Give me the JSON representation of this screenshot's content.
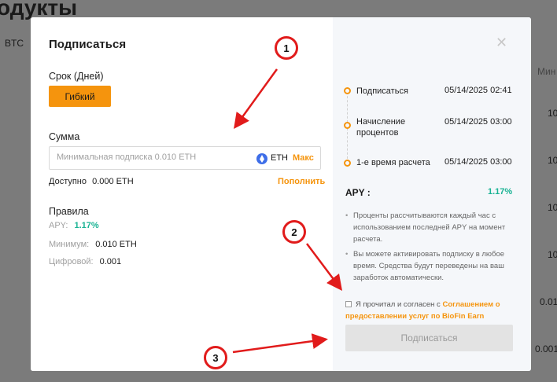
{
  "background": {
    "page_title": "одукты",
    "coin_filter": "BTC",
    "column_header": "Мин",
    "cells": [
      "10",
      "10",
      "10",
      "10",
      "0.01",
      "0.001"
    ]
  },
  "modal": {
    "title": "Подписаться",
    "term_label": "Срок (Дней)",
    "term_option": "Гибкий",
    "amount_label": "Сумма",
    "amount_placeholder": "Минимальная подписка 0.010 ETH",
    "amount_value": "",
    "currency": "ETH",
    "max_label": "Макс",
    "available_label": "Доступно",
    "available_value": "0.000 ETH",
    "topup_label": "Пополнить",
    "rules_title": "Правила",
    "rules": {
      "apy_label": "APY:",
      "apy_value": "1.17%",
      "min_label": "Минимум:",
      "min_value": "0.010 ETH",
      "digits_label": "Цифровой:",
      "digits_value": "0.001"
    },
    "close_icon": "close-icon"
  },
  "timeline": [
    {
      "label_1": "Подписаться",
      "label_2": "",
      "time": "05/14/2025 02:41"
    },
    {
      "label_1": "Начисление",
      "label_2": "процентов",
      "time": "05/14/2025 03:00"
    },
    {
      "label_1": "1-е время расчета",
      "label_2": "",
      "time": "05/14/2025 03:00"
    }
  ],
  "apy": {
    "label": "APY :",
    "value": "1.17%"
  },
  "notes": [
    "Проценты рассчитываются каждый час с использованием последней APY на момент расчета.",
    "Вы можете активировать подписку в любое время. Средства будут переведены на ваш заработок автоматически."
  ],
  "agreement": {
    "text": "Я прочитал и согласен с",
    "link": "Соглашением о предоставлении услуг по BioFin Earn",
    "checked": false
  },
  "subscribe_button": "Подписаться",
  "annotations": [
    "1",
    "2",
    "3"
  ],
  "colors": {
    "accent": "#f5940d",
    "apy_green": "#1ab394",
    "annotation_red": "#e11b1b"
  }
}
